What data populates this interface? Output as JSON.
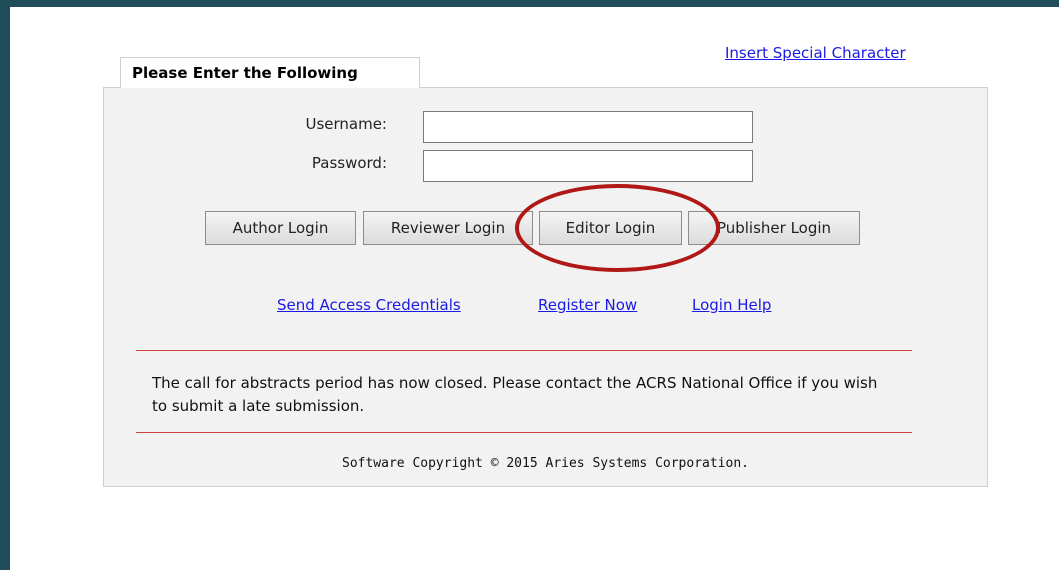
{
  "header": {
    "special_char_link": "Insert Special Character"
  },
  "form": {
    "tab_title": "Please Enter the Following",
    "username_label": "Username:",
    "username_value": "",
    "password_label": "Password:",
    "password_value": ""
  },
  "buttons": {
    "author": "Author Login",
    "reviewer": "Reviewer Login",
    "editor": "Editor Login",
    "publisher": "Publisher Login"
  },
  "links": {
    "send_credentials": "Send Access Credentials",
    "register": "Register Now",
    "help": "Login Help"
  },
  "notice": {
    "text": "The call for abstracts period has now closed. Please contact the ACRS National Office if you wish to submit a late submission."
  },
  "footer": {
    "copyright": "Software Copyright © 2015 Aries Systems Corporation."
  },
  "colors": {
    "frame": "#1f4e5a",
    "link": "#1a1ae6",
    "rule": "#d04040",
    "highlight": "#b01717"
  }
}
